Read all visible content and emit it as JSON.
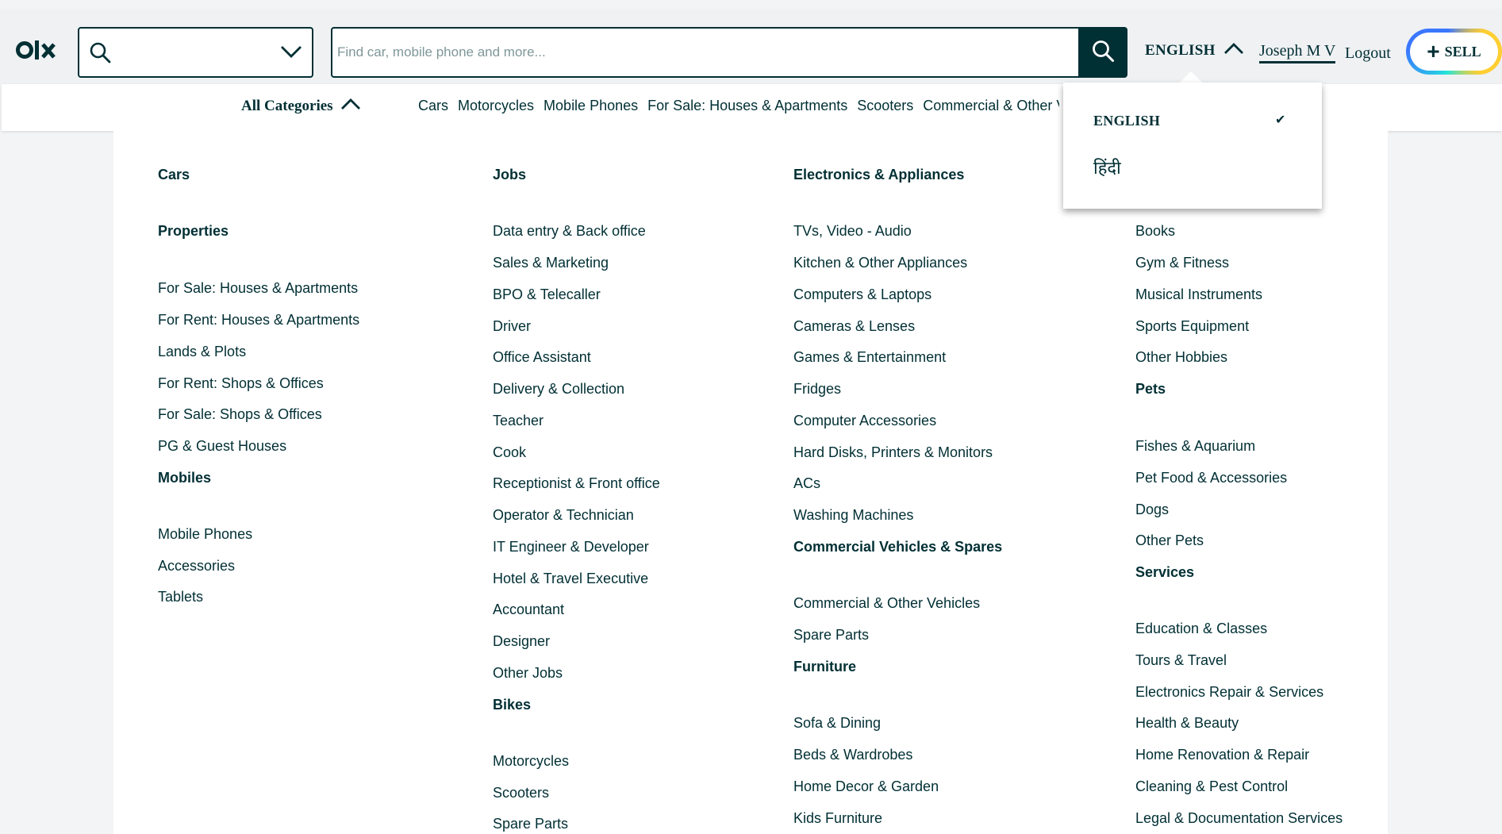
{
  "header": {
    "logo_text": "olx",
    "location_icon": "search-icon",
    "location_chevron_icon": "chevron-down-icon",
    "search_placeholder": "Find car, mobile phone and more...",
    "search_value": "",
    "search_button_icon": "search-icon",
    "language_label": "ENGLISH",
    "language_chevron_icon": "chevron-up-icon",
    "user_name": "Joseph M V",
    "logout_label": "Logout",
    "sell_plus": "+",
    "sell_label": "SELL"
  },
  "category_bar": {
    "all_categories_label": "All Categories",
    "links": [
      "Cars",
      "Motorcycles",
      "Mobile Phones",
      "For Sale: Houses & Apartments",
      "Scooters",
      "Commercial & Other Vehicles"
    ]
  },
  "language_dropdown": {
    "options": [
      {
        "label": "ENGLISH",
        "selected": true
      },
      {
        "label": "हिंदी",
        "selected": false
      }
    ],
    "check_icon": "✔"
  },
  "mega_menu": {
    "columns": [
      [
        {
          "text": "Cars",
          "heading": true
        },
        {
          "text": "Properties",
          "heading": true
        },
        {
          "text": "For Sale: Houses & Apartments",
          "heading": false
        },
        {
          "text": "For Rent: Houses & Apartments",
          "heading": false
        },
        {
          "text": "Lands & Plots",
          "heading": false
        },
        {
          "text": "For Rent: Shops & Offices",
          "heading": false
        },
        {
          "text": "For Sale: Shops & Offices",
          "heading": false
        },
        {
          "text": "PG & Guest Houses",
          "heading": false
        },
        {
          "text": "Mobiles",
          "heading": true
        },
        {
          "text": "Mobile Phones",
          "heading": false
        },
        {
          "text": "Accessories",
          "heading": false
        },
        {
          "text": "Tablets",
          "heading": false
        }
      ],
      [
        {
          "text": "Jobs",
          "heading": true
        },
        {
          "text": "Data entry & Back office",
          "heading": false
        },
        {
          "text": "Sales & Marketing",
          "heading": false
        },
        {
          "text": "BPO & Telecaller",
          "heading": false
        },
        {
          "text": "Driver",
          "heading": false
        },
        {
          "text": "Office Assistant",
          "heading": false
        },
        {
          "text": "Delivery & Collection",
          "heading": false
        },
        {
          "text": "Teacher",
          "heading": false
        },
        {
          "text": "Cook",
          "heading": false
        },
        {
          "text": "Receptionist & Front office",
          "heading": false
        },
        {
          "text": "Operator & Technician",
          "heading": false
        },
        {
          "text": "IT Engineer & Developer",
          "heading": false
        },
        {
          "text": "Hotel & Travel Executive",
          "heading": false
        },
        {
          "text": "Accountant",
          "heading": false
        },
        {
          "text": "Designer",
          "heading": false
        },
        {
          "text": "Other Jobs",
          "heading": false
        },
        {
          "text": "Bikes",
          "heading": true
        },
        {
          "text": "Motorcycles",
          "heading": false
        },
        {
          "text": "Scooters",
          "heading": false
        },
        {
          "text": "Spare Parts",
          "heading": false
        }
      ],
      [
        {
          "text": "Electronics & Appliances",
          "heading": true
        },
        {
          "text": "TVs, Video - Audio",
          "heading": false
        },
        {
          "text": "Kitchen & Other Appliances",
          "heading": false
        },
        {
          "text": "Computers & Laptops",
          "heading": false
        },
        {
          "text": "Cameras & Lenses",
          "heading": false
        },
        {
          "text": "Games & Entertainment",
          "heading": false
        },
        {
          "text": "Fridges",
          "heading": false
        },
        {
          "text": "Computer Accessories",
          "heading": false
        },
        {
          "text": "Hard Disks, Printers & Monitors",
          "heading": false
        },
        {
          "text": "ACs",
          "heading": false
        },
        {
          "text": "Washing Machines",
          "heading": false
        },
        {
          "text": "Commercial Vehicles & Spares",
          "heading": true
        },
        {
          "text": "Commercial & Other Vehicles",
          "heading": false
        },
        {
          "text": "Spare Parts",
          "heading": false
        },
        {
          "text": "Furniture",
          "heading": true
        },
        {
          "text": "Sofa & Dining",
          "heading": false
        },
        {
          "text": "Beds & Wardrobes",
          "heading": false
        },
        {
          "text": "Home Decor & Garden",
          "heading": false
        },
        {
          "text": "Kids Furniture",
          "heading": false
        }
      ],
      [
        {
          "text": "Books",
          "heading": false
        },
        {
          "text": "Gym & Fitness",
          "heading": false
        },
        {
          "text": "Musical Instruments",
          "heading": false
        },
        {
          "text": "Sports Equipment",
          "heading": false
        },
        {
          "text": "Other Hobbies",
          "heading": false
        },
        {
          "text": "Pets",
          "heading": true
        },
        {
          "text": "Fishes & Aquarium",
          "heading": false
        },
        {
          "text": "Pet Food & Accessories",
          "heading": false
        },
        {
          "text": "Dogs",
          "heading": false
        },
        {
          "text": "Other Pets",
          "heading": false
        },
        {
          "text": "Services",
          "heading": true
        },
        {
          "text": "Education & Classes",
          "heading": false
        },
        {
          "text": "Tours & Travel",
          "heading": false
        },
        {
          "text": "Electronics Repair & Services",
          "heading": false
        },
        {
          "text": "Health & Beauty",
          "heading": false
        },
        {
          "text": "Home Renovation & Repair",
          "heading": false
        },
        {
          "text": "Cleaning & Pest Control",
          "heading": false
        },
        {
          "text": "Legal & Documentation Services",
          "heading": false
        }
      ]
    ]
  },
  "colors": {
    "brand_dark": "#002f34",
    "background": "#f2f4f5",
    "sell_ring": [
      "#23e5db",
      "#3a77ff",
      "#ffce32"
    ]
  }
}
